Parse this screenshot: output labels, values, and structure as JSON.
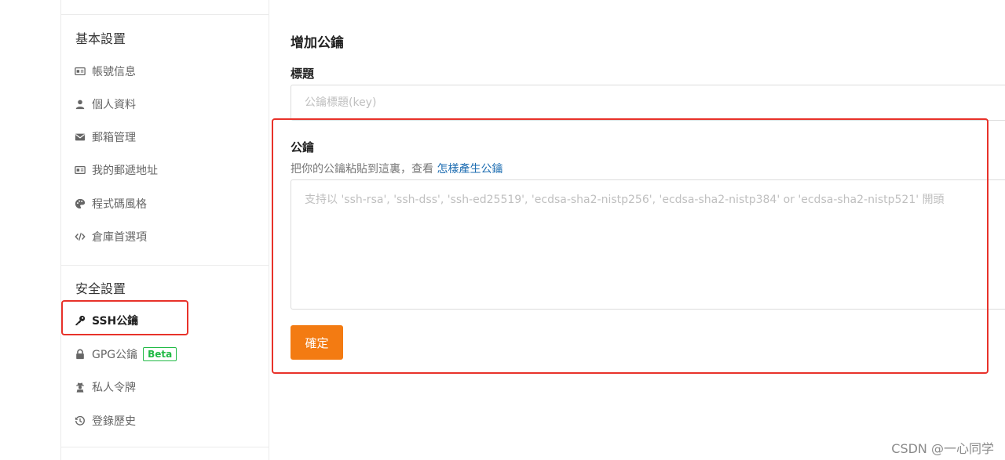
{
  "sidebar": {
    "basic_section_title": "基本設置",
    "basic_items": [
      {
        "label": "帳號信息",
        "icon": "id-card-icon"
      },
      {
        "label": "個人資料",
        "icon": "user-icon"
      },
      {
        "label": "郵箱管理",
        "icon": "envelope-icon"
      },
      {
        "label": "我的郵遞地址",
        "icon": "address-card-icon"
      },
      {
        "label": "程式碼風格",
        "icon": "palette-icon"
      },
      {
        "label": "倉庫首選項",
        "icon": "code-icon"
      }
    ],
    "security_section_title": "安全設置",
    "security_items": [
      {
        "label": "SSH公鑰",
        "icon": "key-icon",
        "active": true
      },
      {
        "label": "GPG公鑰",
        "icon": "lock-icon",
        "badge": "Beta"
      },
      {
        "label": "私人令牌",
        "icon": "user-secret-icon"
      },
      {
        "label": "登錄歷史",
        "icon": "history-icon"
      }
    ]
  },
  "main": {
    "title": "增加公鑰",
    "title_field_label": "標題",
    "title_placeholder": "公鑰標題(key)",
    "key_field_label": "公鑰",
    "help_text": "把你的公鑰粘貼到這裏，查看",
    "help_link": "怎樣產生公鑰",
    "key_placeholder": "支持以 'ssh-rsa', 'ssh-dss', 'ssh-ed25519', 'ecdsa-sha2-nistp256', 'ecdsa-sha2-nistp384' or 'ecdsa-sha2-nistp521' 開頭",
    "confirm_label": "確定"
  },
  "watermark": "CSDN @一心同学",
  "colors": {
    "accent": "#f37b12",
    "link": "#1a6bb0",
    "highlight": "#e8322a",
    "beta": "#21ba45"
  }
}
